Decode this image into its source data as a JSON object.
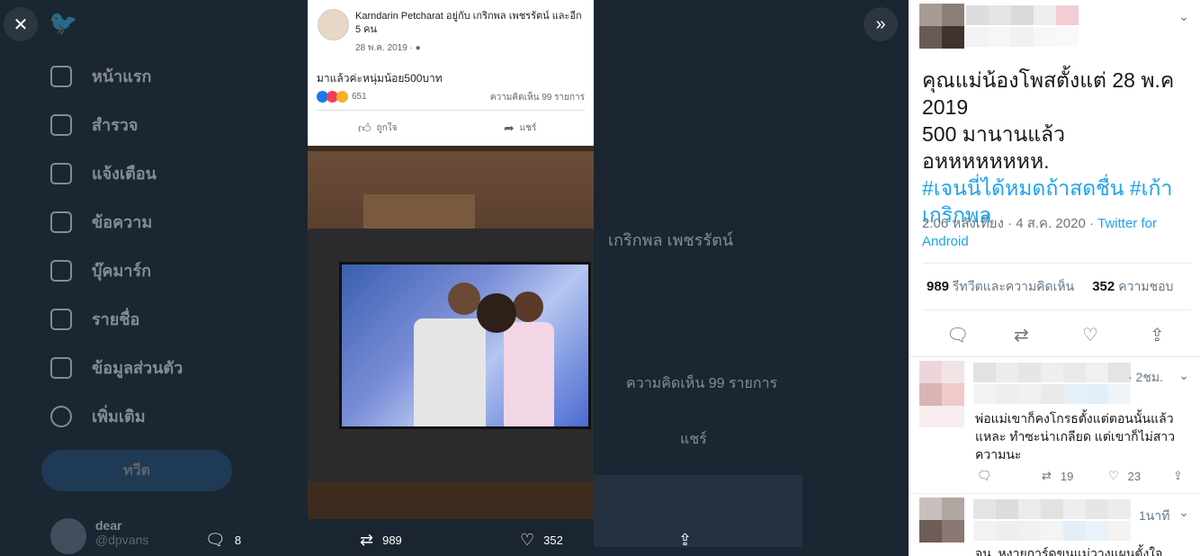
{
  "nav": {
    "items": [
      {
        "label": "หน้าแรก",
        "icon": "home-icon"
      },
      {
        "label": "สำรวจ",
        "icon": "hashtag-icon"
      },
      {
        "label": "แจ้งเตือน",
        "icon": "bell-icon"
      },
      {
        "label": "ข้อความ",
        "icon": "mail-icon"
      },
      {
        "label": "บุ๊คมาร์ก",
        "icon": "bookmark-icon"
      },
      {
        "label": "รายชื่อ",
        "icon": "list-icon"
      },
      {
        "label": "ข้อมูลส่วนตัว",
        "icon": "profile-icon"
      },
      {
        "label": "เพิ่มเติม",
        "icon": "more-icon"
      }
    ],
    "tweet_button": "ทวีต",
    "user": {
      "name": "dear",
      "handle": "@dpvans"
    }
  },
  "background": {
    "comments_text": "ความคิดเห็น 99 รายการ",
    "share_text": "แชร์",
    "name_text": "เกริกพล เพชรรัตน์"
  },
  "fb_post": {
    "author": "Karndarin Petcharat",
    "with_text": "อยู่กับ เกริกพล เพชรรัตน์ และอีก 5 คน",
    "date": "28 พ.ค. 2019 · ",
    "text": "มาแล้วค่ะหนุ่มน้อย500บาท",
    "reactions_count": "651",
    "comments": "ความคิดเห็น 99 รายการ",
    "like": "ถูกใจ",
    "share": "แชร์"
  },
  "media_bar": {
    "replies": "8",
    "retweets": "989",
    "likes": "352"
  },
  "tweet": {
    "text_line1": "คุณแม่น้องโพสตั้งแต่ 28 พ.ค 2019",
    "text_line2": "500 มานานแล้ว อหหหหหหหห.",
    "hashtag1": "#เจนนี่ได้หมดถ้าสดชื่น",
    "hashtag2": "#เก้าเกริกพล",
    "time": "2:06 หลังเที่ยง · 4 ส.ค. 2020 · ",
    "source": "Twitter for Android",
    "retweets_count": "989",
    "retweets_label": "รีทวีตและความคิดเห็น",
    "likes_count": "352",
    "likes_label": "ความชอบ"
  },
  "replies": [
    {
      "time": "· 2ชม.",
      "text": "พ่อแม่เขาก็คงโกรธตั้งแต่ตอนนั้นแล้วแหละ ทำซะน่าเกลียด แต่เขาก็ไม่สาวความนะ",
      "retweets": "19",
      "likes": "23"
    },
    {
      "time": "1นาที",
      "text": "จน. หงายการ์ดขนแม่วางแผนตั้งใจโพสต์"
    }
  ],
  "colors": {
    "accent": "#1da1f2",
    "overlay": "#1f2b38"
  }
}
